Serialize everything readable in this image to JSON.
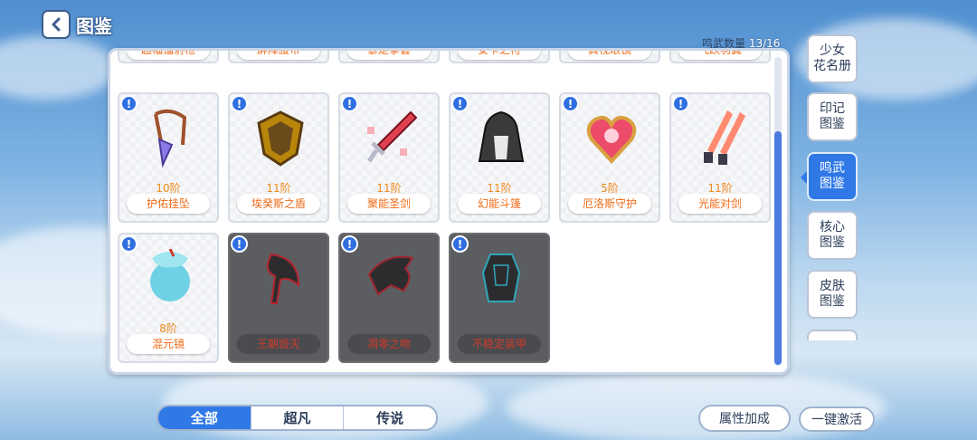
{
  "header": {
    "title": "图鉴",
    "count_label": "鸣武数量",
    "count_value": "13/16"
  },
  "top_row": [
    "超幅镭射枪",
    "屏障腰带",
    "暴走拳套",
    "安卡之符",
    "真视眼镜",
    "飞跃羽翼"
  ],
  "cards": [
    {
      "tier": "10阶",
      "name": "护佑挂坠",
      "locked": false,
      "icon": "pendant-icon",
      "color": "#a0522d"
    },
    {
      "tier": "11阶",
      "name": "埃癸斯之盾",
      "locked": false,
      "icon": "shield-icon",
      "color": "#b8860b"
    },
    {
      "tier": "11阶",
      "name": "聚能圣剑",
      "locked": false,
      "icon": "sword-icon",
      "color": "#e0424f"
    },
    {
      "tier": "11阶",
      "name": "幻能斗篷",
      "locked": false,
      "icon": "cloak-icon",
      "color": "#3a3a3a"
    },
    {
      "tier": "5阶",
      "name": "厄洛斯守护",
      "locked": false,
      "icon": "heart-icon",
      "color": "#ec4c6a"
    },
    {
      "tier": "11阶",
      "name": "光能对剑",
      "locked": false,
      "icon": "twin-blades-icon",
      "color": "#ff8a70"
    },
    {
      "tier": "8阶",
      "name": "混元镜",
      "locked": false,
      "icon": "mirror-icon",
      "color": "#4fc8e0"
    },
    {
      "tier": "",
      "name": "王朝毁灭",
      "locked": true,
      "icon": "axe-icon",
      "color": "#b3262e"
    },
    {
      "tier": "",
      "name": "凋零之吻",
      "locked": true,
      "icon": "claw-icon",
      "color": "#a0262e"
    },
    {
      "tier": "",
      "name": "不稳定装甲",
      "locked": true,
      "icon": "armor-icon",
      "color": "#2fa7b8"
    }
  ],
  "side_tabs": [
    {
      "label": "少女\n花名册",
      "active": false
    },
    {
      "label": "印记\n图鉴",
      "active": false
    },
    {
      "label": "鸣武\n图鉴",
      "active": true
    },
    {
      "label": "核心\n图鉴",
      "active": false
    },
    {
      "label": "皮肤\n图鉴",
      "active": false
    }
  ],
  "filters": [
    {
      "label": "全部",
      "active": true
    },
    {
      "label": "超凡",
      "active": false
    },
    {
      "label": "传说",
      "active": false
    }
  ],
  "buttons": {
    "attribute_bonus": "属性加成",
    "activate_all": "一键激活"
  },
  "colors": {
    "accent": "#2f78e6",
    "tier": "#f08a1c",
    "name": "#ef6b18",
    "locked_name": "#d23a2a"
  }
}
